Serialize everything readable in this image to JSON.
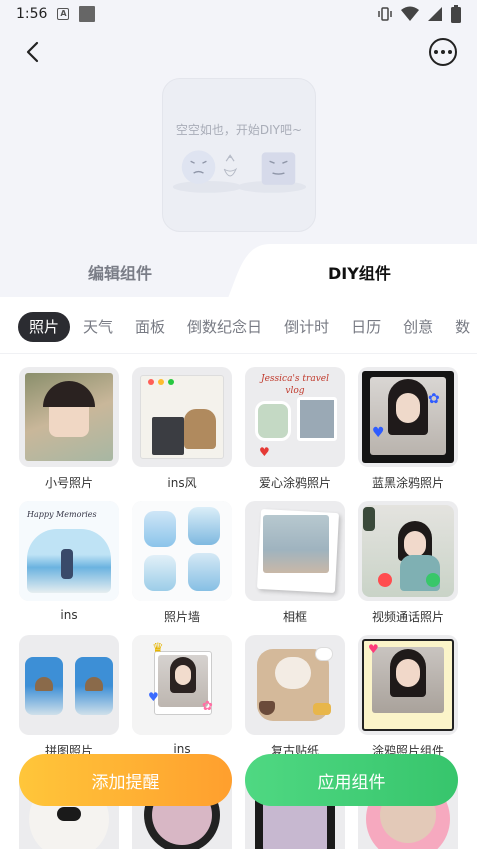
{
  "status": {
    "time": "1:56",
    "icons": [
      "a-icon",
      "square-icon",
      "vibrate-icon",
      "wifi-icon",
      "signal-icon",
      "battery-icon"
    ]
  },
  "nav": {
    "back_icon": "chevron-left-icon",
    "more_icon": "more-icon"
  },
  "preview": {
    "empty_text": "空空如也，开始DIY吧~"
  },
  "tabs": [
    {
      "label": "编辑组件",
      "active": false
    },
    {
      "label": "DIY组件",
      "active": true
    }
  ],
  "categories": [
    {
      "label": "照片",
      "active": true
    },
    {
      "label": "天气"
    },
    {
      "label": "面板"
    },
    {
      "label": "倒数纪念日"
    },
    {
      "label": "倒计时"
    },
    {
      "label": "日历"
    },
    {
      "label": "创意"
    },
    {
      "label": "数"
    }
  ],
  "widgets": [
    {
      "label": "小号照片"
    },
    {
      "label": "ins风"
    },
    {
      "label": "爱心涂鸦照片"
    },
    {
      "label": "蓝黑涂鸦照片"
    },
    {
      "label": "ins"
    },
    {
      "label": "照片墙"
    },
    {
      "label": "相框"
    },
    {
      "label": "视频通话照片"
    },
    {
      "label": "拼图照片"
    },
    {
      "label": "ins"
    },
    {
      "label": "复古贴纸"
    },
    {
      "label": "涂鸦照片组件"
    }
  ],
  "thumb_text": {
    "happy_memories": "Happy Memories",
    "travel_vlog": "Jessica's travel vlog"
  },
  "actions": {
    "remind_label": "添加提醒",
    "apply_label": "应用组件"
  },
  "colors": {
    "accent_dark": "#2b2c31",
    "remind_orange": "#ffb035",
    "apply_green": "#42cf77"
  }
}
